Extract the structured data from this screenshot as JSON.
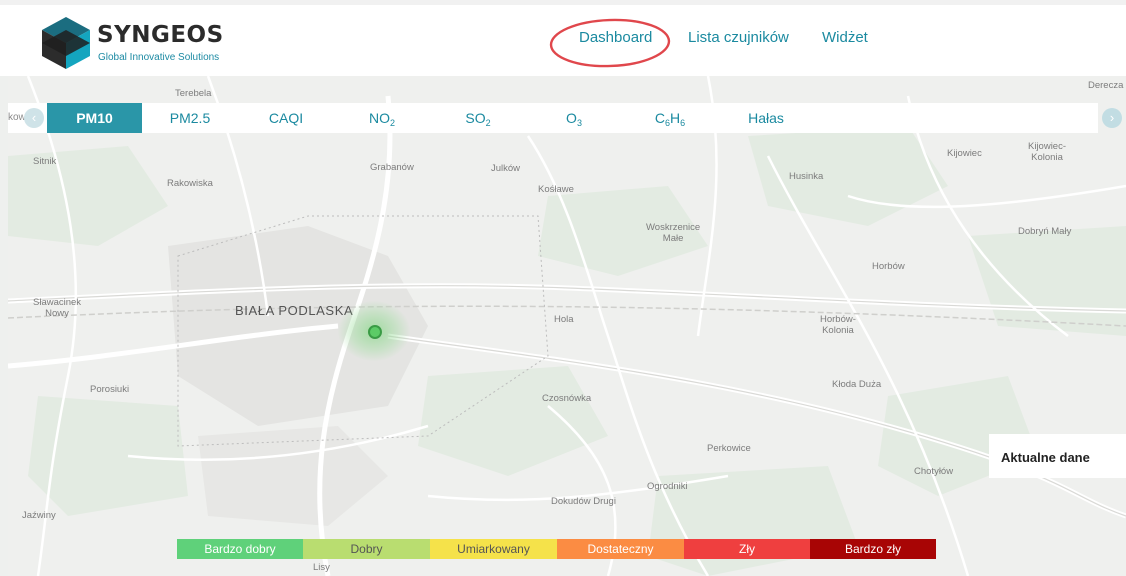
{
  "header": {
    "logo_title": "SYNGEOS",
    "logo_subtitle": "Global Innovative Solutions",
    "nav": [
      {
        "label": "Dashboard"
      },
      {
        "label": "Lista czujników"
      },
      {
        "label": "Widżet"
      }
    ],
    "highlight_color": "#e0474c"
  },
  "tabs": {
    "prev_label": "kowce",
    "items": [
      {
        "main": "PM10",
        "sub": ""
      },
      {
        "main": "PM2.5",
        "sub": ""
      },
      {
        "main": "CAQI",
        "sub": ""
      },
      {
        "main": "NO",
        "sub": "2"
      },
      {
        "main": "SO",
        "sub": "2"
      },
      {
        "main": "O",
        "sub": "3"
      },
      {
        "main": "C6H6",
        "sub": ""
      },
      {
        "main": "Hałas",
        "sub": ""
      }
    ],
    "c6h6": {
      "c": "C",
      "n1": "6",
      "h": "H",
      "n2": "6"
    },
    "active_index": 0,
    "prev_icon": "chevron-left-icon",
    "next_icon": "chevron-right-icon"
  },
  "map": {
    "places": [
      "Derecza",
      "Terebela",
      "Sitnik",
      "Rakowiska",
      "Grabanów",
      "Julków",
      "Kośławe",
      "Husinka",
      "Kijowiec",
      "Kijowiec-\nKolonia",
      "Woskrzenice\nMałe",
      "Dobryń Mały",
      "Horbów",
      "Sławacinek\nNowy",
      "BIAŁA PODLASKA",
      "Hola",
      "Horbów-\nKolonia",
      "Porosiuki",
      "Czosnówka",
      "Kłoda Duża",
      "Perkowice",
      "Chotyłów",
      "Ogrodniki",
      "Dokudów Drugi",
      "Jaźwiny",
      "Lisy"
    ],
    "sensor_color": "#5ccb66"
  },
  "panel": {
    "title": "Aktualne dane"
  },
  "legend": [
    {
      "label": "Bardzo dobry",
      "color": "#5fd17a"
    },
    {
      "label": "Dobry",
      "color": "#b9dd70"
    },
    {
      "label": "Umiarkowany",
      "color": "#f5e24a"
    },
    {
      "label": "Dostateczny",
      "color": "#fb8c43"
    },
    {
      "label": "Zły",
      "color": "#ef3f3f"
    },
    {
      "label": "Bardzo zły",
      "color": "#a80505"
    }
  ]
}
